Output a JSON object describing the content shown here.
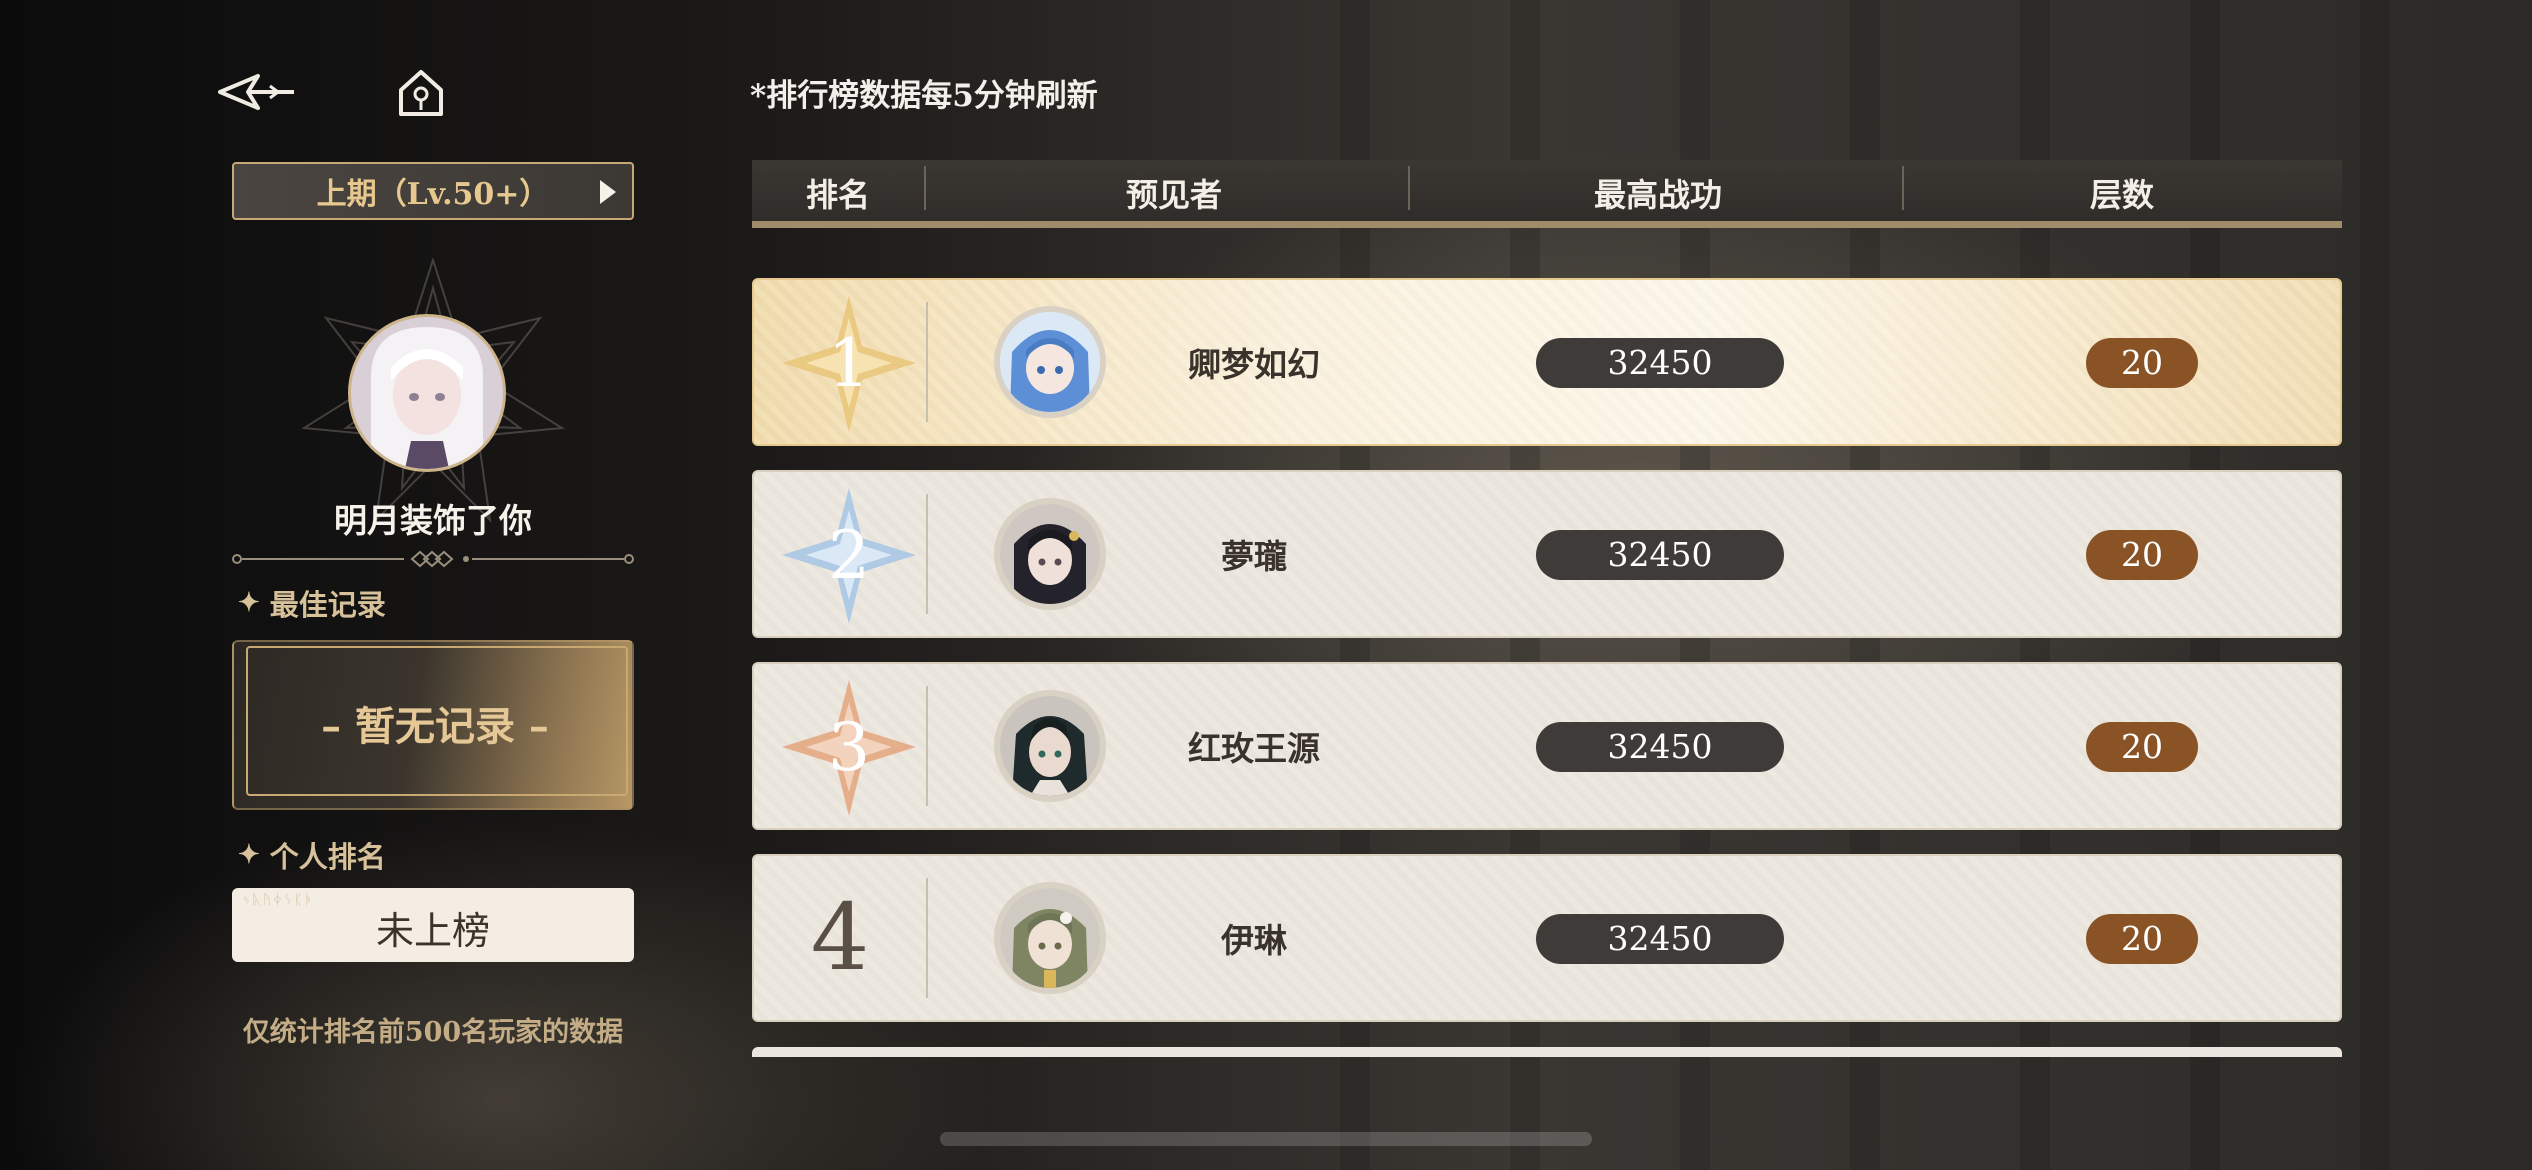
{
  "refresh_note": "*排行榜数据每5分钟刷新",
  "left_panel": {
    "period_label": "上期（Lv.50+）",
    "player_name": "明月装饰了你",
    "best_record_title": "最佳记录",
    "best_record_value": "– 暂无记录 –",
    "personal_rank_title": "个人排名",
    "personal_rank_value": "未上榜",
    "footnote": "仅统计排名前500名玩家的数据"
  },
  "table": {
    "headers": [
      "排名",
      "预见者",
      "最高战功",
      "层数"
    ],
    "rows": [
      {
        "rank": "1",
        "name": "卿梦如幻",
        "power": "32450",
        "floor": "20",
        "avatar_hair": "#5d8fd6",
        "avatar_skin": "#f6e6e0"
      },
      {
        "rank": "2",
        "name": "夢瓏",
        "power": "32450",
        "floor": "20",
        "avatar_hair": "#24222a",
        "avatar_skin": "#efe1da"
      },
      {
        "rank": "3",
        "name": "红玫王源",
        "power": "32450",
        "floor": "20",
        "avatar_hair": "#1f2a2c",
        "avatar_skin": "#ead9cf"
      },
      {
        "rank": "4",
        "name": "伊琳",
        "power": "32450",
        "floor": "20",
        "avatar_hair": "#7f8563",
        "avatar_skin": "#efe1d3"
      }
    ]
  },
  "colors": {
    "gold_accent": "#c9a877",
    "power_pill": "#3f3b38",
    "floor_pill": "#8a5326",
    "rank1_medal": "#e9c77c",
    "rank2_medal": "#a9c6e4",
    "rank3_medal": "#e3a57b"
  },
  "icons": [
    "back-arrow-icon",
    "home-icon",
    "sparkle-icon",
    "play-arrow-icon"
  ]
}
